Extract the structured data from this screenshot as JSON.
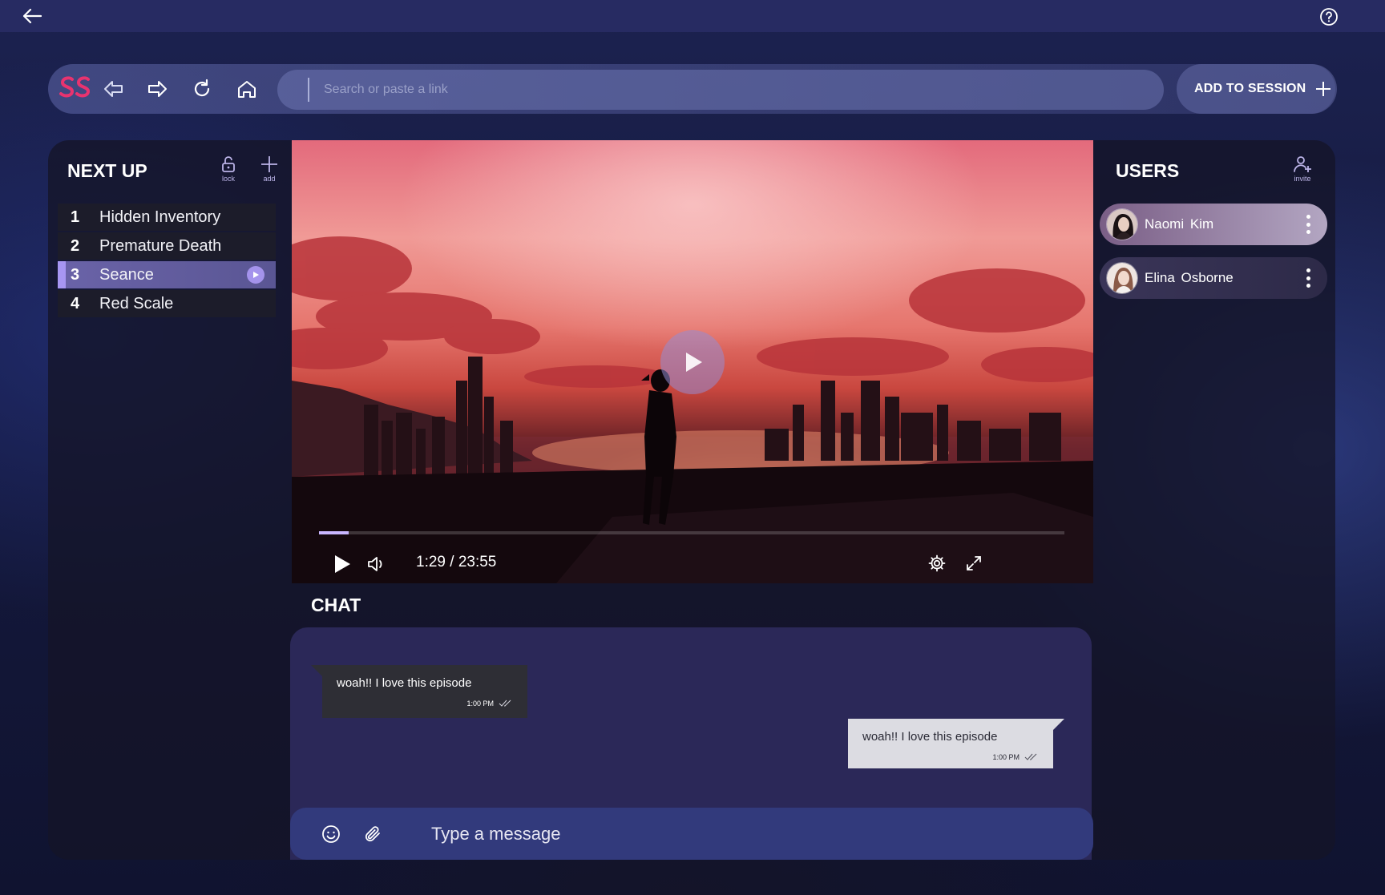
{
  "header": {
    "back_icon": "arrow-left-icon",
    "help_icon": "question-circle-icon"
  },
  "browser": {
    "logo_text": "SS",
    "search_placeholder": "Search or paste a link",
    "add_to_session_label": "ADD TO SESSION"
  },
  "next_up": {
    "title": "NEXT UP",
    "lock_label": "lock",
    "add_label": "add",
    "items": [
      {
        "num": "1",
        "title": "Hidden Inventory"
      },
      {
        "num": "2",
        "title": "Premature Death"
      },
      {
        "num": "3",
        "title": "Seance"
      },
      {
        "num": "4",
        "title": "Red Scale"
      }
    ],
    "active_index": 2
  },
  "player": {
    "time": "1:29 / 23:55",
    "progress": 0.04
  },
  "chat": {
    "title": "CHAT",
    "messages": [
      {
        "direction": "in",
        "text": "woah!! I love this episode",
        "time": "1:00 PM"
      },
      {
        "direction": "out",
        "text": "woah!! I love this episode",
        "time": "1:00 PM"
      }
    ],
    "composer_placeholder": "Type a message"
  },
  "users": {
    "title": "USERS",
    "invite_label": "invite",
    "list": [
      {
        "name": "Naomi  Kim"
      },
      {
        "name": "Elina Osborne"
      }
    ]
  },
  "colors": {
    "accent": "#a493ec",
    "logo": "#e8336f",
    "topbar": "#272b62"
  }
}
